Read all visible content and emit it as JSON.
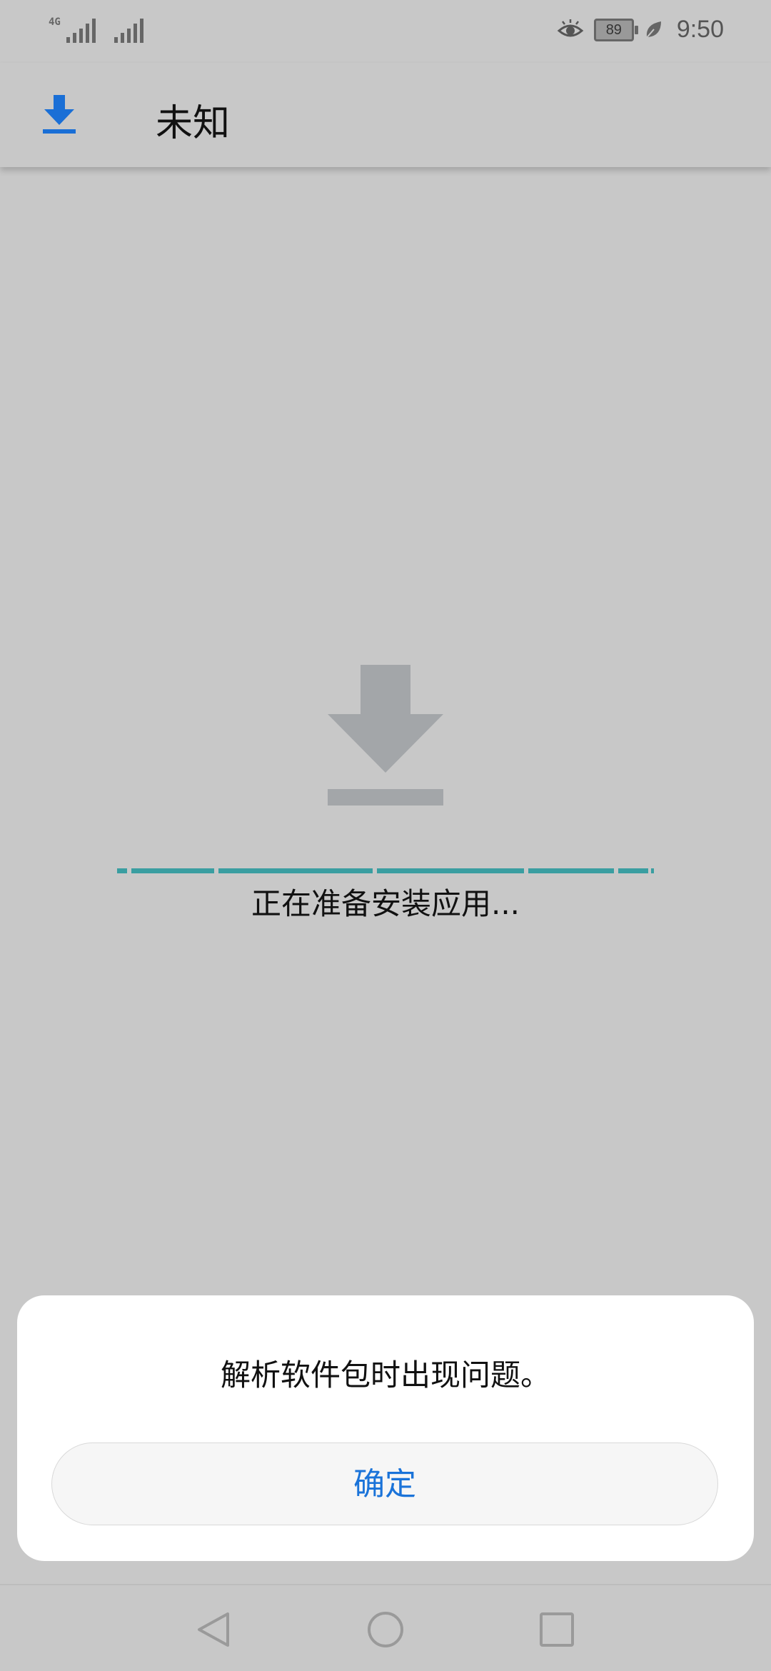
{
  "status_bar": {
    "network_type": "4G",
    "battery_level": "89",
    "time": "9:50",
    "icons": [
      "signal-4g-icon",
      "signal-icon",
      "eye-comfort-icon",
      "battery-icon",
      "power-saving-leaf-icon"
    ]
  },
  "app_bar": {
    "title": "未知",
    "icon": "download-icon",
    "accent_color": "#1a6fd6"
  },
  "main": {
    "icon": "download-icon",
    "icon_color": "#a3a6a9",
    "status_text": "正在准备安装应用...",
    "progress_color": "#3a9ea1"
  },
  "dialog": {
    "message": "解析软件包时出现问题。",
    "ok_label": "确定",
    "ok_color": "#1a73d9"
  },
  "nav_bar": {
    "icons": [
      "back-icon",
      "home-icon",
      "recents-icon"
    ]
  }
}
